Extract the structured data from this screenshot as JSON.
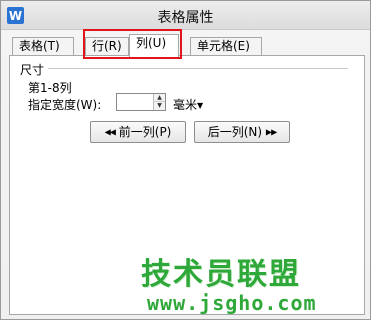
{
  "window": {
    "title": "表格属性",
    "icon": "W"
  },
  "tabs": [
    {
      "label": "表格(T)"
    },
    {
      "label": "行(R)"
    },
    {
      "label": "列(U)",
      "selected": true
    },
    {
      "label": "单元格(E)"
    }
  ],
  "size_group": {
    "label": "尺寸",
    "range": "第1-8列",
    "width_label": "指定宽度(W):",
    "width_value": "",
    "unit": "毫米"
  },
  "buttons": {
    "prev_label": "前一列(P)",
    "next_label": "后一列(N)"
  },
  "watermark": {
    "text": "技术员联盟",
    "url": "www.jsgho.com"
  },
  "colors": {
    "highlight": "#e0161c",
    "watermark": "#2ea838",
    "app_icon": "#2b73d3"
  }
}
